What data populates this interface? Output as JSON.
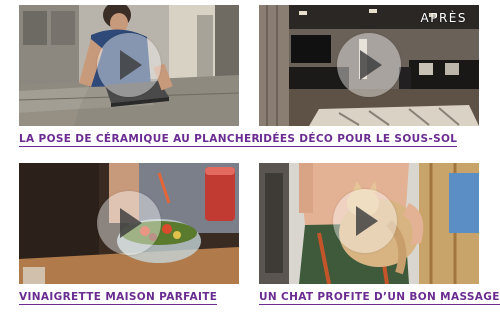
{
  "videos": [
    {
      "title": "LA POSE DE CÉRAMIQUE AU PLANCHER",
      "overlay": ""
    },
    {
      "title": "IDÉES DÉCO POUR LE SOUS-SOL",
      "overlay": "APRÈS"
    },
    {
      "title": "VINAIGRETTE MAISON PARFAITE",
      "overlay": ""
    },
    {
      "title": "UN CHAT PROFITE D’UN BON MASSAGE",
      "overlay": ""
    }
  ],
  "colors": {
    "caption": "#6a2c91",
    "background": "#ffffff"
  },
  "icons": {
    "play": "play-icon"
  }
}
